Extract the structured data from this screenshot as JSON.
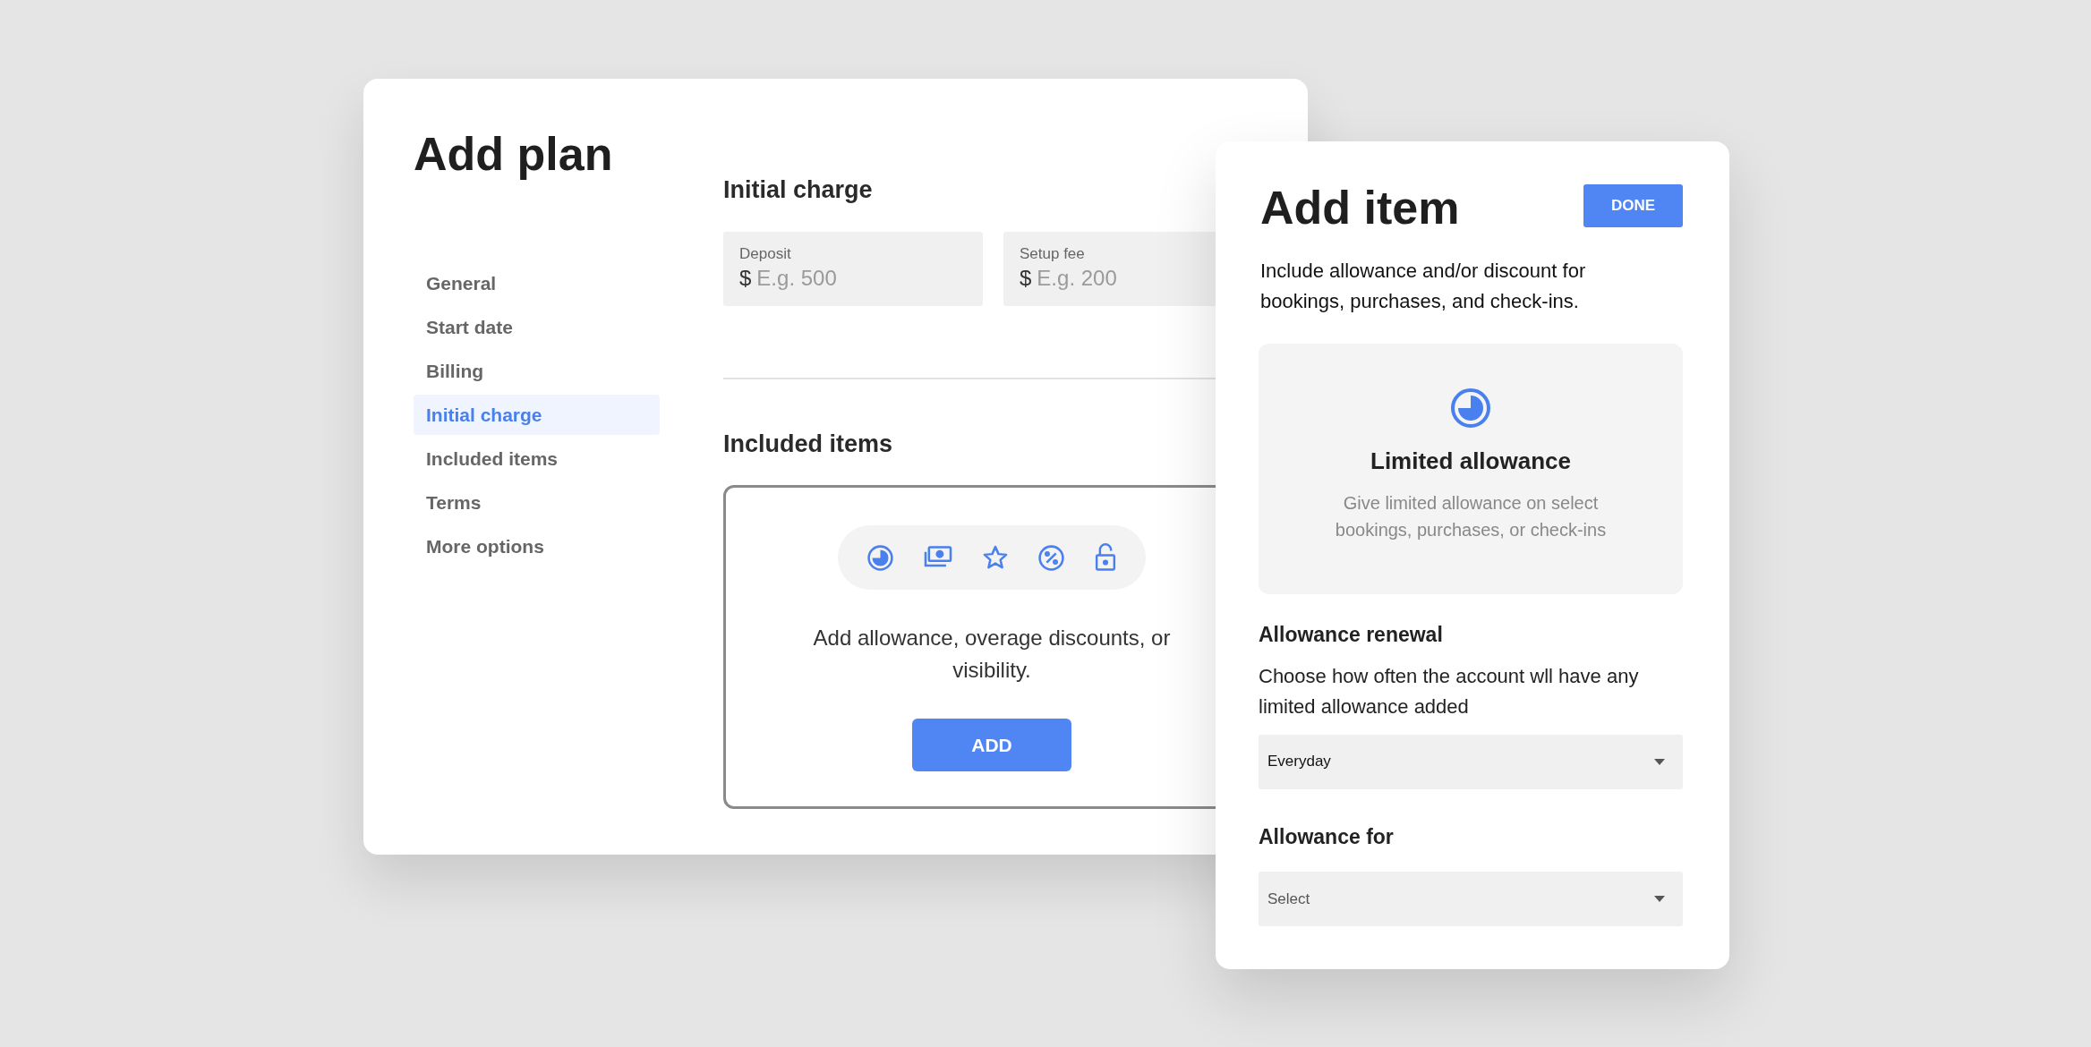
{
  "add_plan": {
    "title": "Add plan",
    "nav_items": [
      {
        "label": "General",
        "selected": false
      },
      {
        "label": "Start date",
        "selected": false
      },
      {
        "label": "Billing",
        "selected": false
      },
      {
        "label": "Initial charge",
        "selected": true
      },
      {
        "label": "Included items",
        "selected": false
      },
      {
        "label": "Terms",
        "selected": false
      },
      {
        "label": "More options",
        "selected": false
      }
    ],
    "initial_charge": {
      "heading": "Initial charge",
      "fields": [
        {
          "label": "Deposit",
          "prefix": "$",
          "placeholder": "E.g. 500"
        },
        {
          "label": "Setup fee",
          "prefix": "$",
          "placeholder": "E.g. 200"
        }
      ]
    },
    "included_items": {
      "heading": "Included items",
      "message": "Add allowance, overage discounts, or visibility.",
      "button": "ADD"
    }
  },
  "add_item": {
    "title": "Add item",
    "done_button": "DONE",
    "description": "Include allowance and/or discount for bookings, purchases, and check-ins.",
    "option_card": {
      "title": "Limited allowance",
      "description": "Give limited allowance on select bookings, purchases, or check-ins"
    },
    "renewal": {
      "heading": "Allowance renewal",
      "description": "Choose how often the account wll have any limited allowance added",
      "value": "Everyday"
    },
    "allowance_for": {
      "heading": "Allowance for",
      "placeholder": "Select"
    }
  }
}
